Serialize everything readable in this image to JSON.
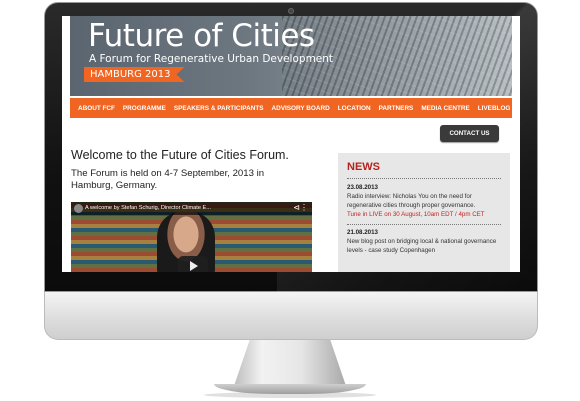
{
  "banner": {
    "title": "Future of Cities",
    "subtitle": "A Forum for Regenerative Urban Development",
    "ribbon": "HAMBURG 2013"
  },
  "nav": {
    "items": [
      "ABOUT FCF",
      "PROGRAMME",
      "SPEAKERS & PARTICIPANTS",
      "ADVISORY BOARD",
      "LOCATION",
      "PARTNERS",
      "MEDIA CENTRE",
      "LIVEBLOG"
    ]
  },
  "contact": {
    "label": "CONTACT US"
  },
  "main": {
    "welcome": "Welcome to the Future of Cities Forum.",
    "held": "The Forum is held on 4-7 September, 2013 in Hamburg, Germany."
  },
  "video": {
    "title": "A welcome by Stefan Schurig, Director Climate E..."
  },
  "news": {
    "heading": "NEWS",
    "items": [
      {
        "date": "23.08.2013",
        "text": "Radio interview: Nicholas You on the need for regenerative cities through proper governance.",
        "link": "Tune in LIVE on 30 August, 10am EDT / 4pm CET"
      },
      {
        "date": "21.08.2013",
        "text": "New blog post on bridging local & national governance levels - case study Copenhagen",
        "link": ""
      }
    ]
  },
  "colors": {
    "accent": "#f06522",
    "news_heading": "#b5231e",
    "news_panel": "#e7e7e7"
  }
}
